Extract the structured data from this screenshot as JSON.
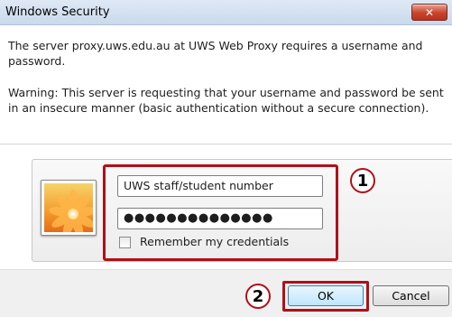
{
  "window": {
    "title": "Windows Security",
    "close_label": "✕"
  },
  "message": {
    "line1": "The server proxy.uws.edu.au at UWS Web Proxy requires a username and password.",
    "warning": "Warning: This server is requesting that your username and password be sent in an insecure manner (basic authentication without a secure connection)."
  },
  "credentials": {
    "username_value": "UWS staff/student number",
    "password_value": "●●●●●●●●●●●●●●",
    "remember_label": "Remember my credentials",
    "remember_checked": false
  },
  "annotations": {
    "step1": "1",
    "step2": "2",
    "highlight_color": "#b10f19"
  },
  "buttons": {
    "ok_label": "OK",
    "cancel_label": "Cancel"
  },
  "icons": {
    "avatar": "flower-avatar-icon"
  }
}
